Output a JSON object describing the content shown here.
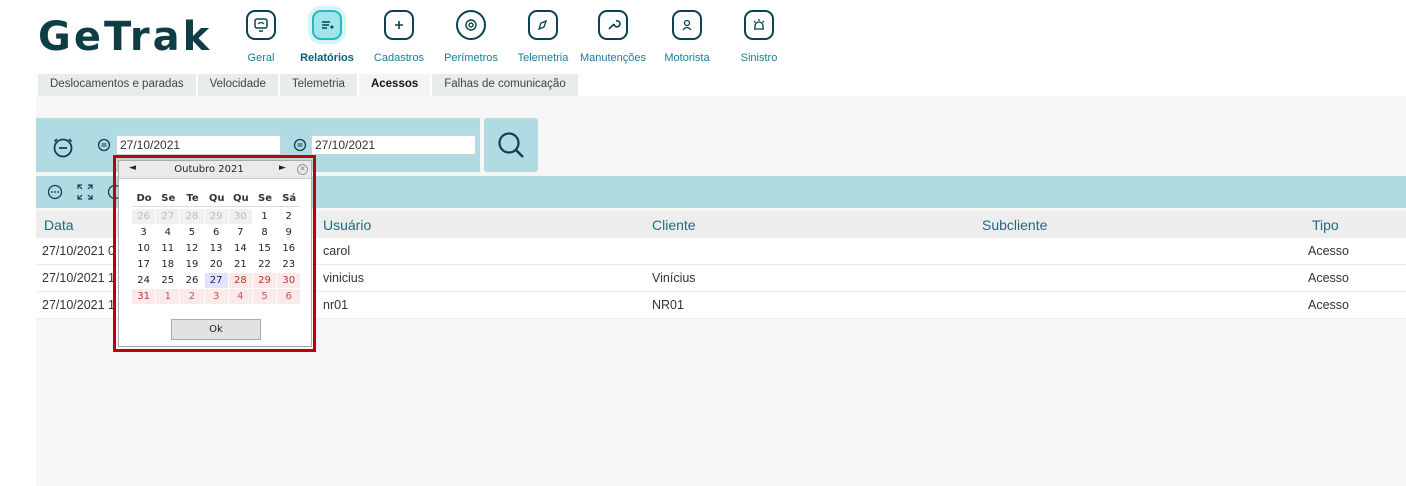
{
  "logo": "GeTrak",
  "nav": [
    {
      "label": "Geral",
      "icon": "monitor-icon"
    },
    {
      "label": "Relatórios",
      "icon": "report-icon",
      "active": true
    },
    {
      "label": "Cadastros",
      "icon": "folder-plus-icon"
    },
    {
      "label": "Perímetros",
      "icon": "target-icon"
    },
    {
      "label": "Telemetria",
      "icon": "compass-icon"
    },
    {
      "label": "Manutenções",
      "icon": "wrench-icon"
    },
    {
      "label": "Motorista",
      "icon": "driver-icon"
    },
    {
      "label": "Sinistro",
      "icon": "alarm-icon"
    }
  ],
  "tabs": [
    {
      "label": "Deslocamentos e paradas"
    },
    {
      "label": "Velocidade"
    },
    {
      "label": "Telemetria"
    },
    {
      "label": "Acessos",
      "active": true
    },
    {
      "label": "Falhas de comunicação"
    }
  ],
  "filter": {
    "start_date": "27/10/2021",
    "end_date": "27/10/2021"
  },
  "table": {
    "headers": {
      "data": "Data",
      "usuario": "Usuário",
      "cliente": "Cliente",
      "subcliente": "Subcliente",
      "tipo": "Tipo"
    },
    "rows": [
      {
        "data": "27/10/2021 0",
        "usuario": "carol",
        "cliente": "",
        "subcliente": "",
        "tipo": "Acesso"
      },
      {
        "data": "27/10/2021 1",
        "usuario": "vinicius",
        "cliente": "Vinícius",
        "subcliente": "",
        "tipo": "Acesso"
      },
      {
        "data": "27/10/2021 1",
        "usuario": "nr01",
        "cliente": "NR01",
        "subcliente": "",
        "tipo": "Acesso"
      }
    ]
  },
  "datepicker": {
    "prev": "◄",
    "next": "►",
    "title": "Outubro 2021",
    "close": "✕",
    "weekdays": [
      "Do",
      "Se",
      "Te",
      "Qu",
      "Qu",
      "Se",
      "Sá"
    ],
    "weeks": [
      [
        "26",
        "27",
        "28",
        "29",
        "30",
        "1",
        "2"
      ],
      [
        "3",
        "4",
        "5",
        "6",
        "7",
        "8",
        "9"
      ],
      [
        "10",
        "11",
        "12",
        "13",
        "14",
        "15",
        "16"
      ],
      [
        "17",
        "18",
        "19",
        "20",
        "21",
        "22",
        "23"
      ],
      [
        "24",
        "25",
        "26",
        "27",
        "28",
        "29",
        "30"
      ],
      [
        "31",
        "1",
        "2",
        "3",
        "4",
        "5",
        "6"
      ]
    ],
    "selected_day": "27",
    "ok_label": "Ok"
  },
  "colors": {
    "accent": "#b1dbe3",
    "brand": "#0f3d45",
    "link": "#1b6a82",
    "highlight": "#c00000"
  }
}
